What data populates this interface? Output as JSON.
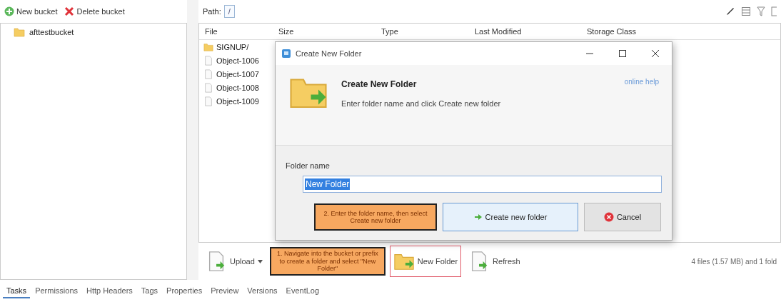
{
  "left_toolbar": {
    "buttons": [
      {
        "kind": "add",
        "label": "New bucket"
      },
      {
        "kind": "delete",
        "label": "Delete bucket"
      }
    ]
  },
  "tree": {
    "items": [
      {
        "label": "afttestbucket",
        "selected": false
      }
    ]
  },
  "path_bar": {
    "label": "Path:",
    "value": "/"
  },
  "table": {
    "columns": [
      "File",
      "Size",
      "Type",
      "Last Modified",
      "Storage Class"
    ],
    "rows": [
      {
        "kind": "folder",
        "name": "SIGNUP/"
      },
      {
        "kind": "file",
        "name": "Object-1006"
      },
      {
        "kind": "file",
        "name": "Object-1007"
      },
      {
        "kind": "file",
        "name": "Object-1008"
      },
      {
        "kind": "file",
        "name": "Object-1009"
      }
    ]
  },
  "bottom_toolbar": {
    "upload": "Upload",
    "callout": "1. Navigate into the bucket or prefix to create a folder and select \"New Folder\"",
    "new_folder": "New Folder",
    "refresh": "Refresh",
    "status": "4 files (1.57 MB) and 1 fold"
  },
  "tabs": [
    {
      "label": "Tasks",
      "selected": true
    },
    {
      "label": "Permissions",
      "selected": false
    },
    {
      "label": "Http Headers",
      "selected": false
    },
    {
      "label": "Tags",
      "selected": false
    },
    {
      "label": "Properties",
      "selected": false
    },
    {
      "label": "Preview",
      "selected": false
    },
    {
      "label": "Versions",
      "selected": false
    },
    {
      "label": "EventLog",
      "selected": false
    }
  ],
  "dialog": {
    "title": "Create New Folder",
    "heading": "Create New Folder",
    "help_link": "online help",
    "instruction": "Enter folder name and click Create new folder",
    "field_label": "Folder name",
    "field_value": "New Folder",
    "value_selected": true,
    "callout": "2. Enter the folder name, then select Create new folder",
    "create_button": "Create new folder",
    "cancel_button": "Cancel"
  }
}
